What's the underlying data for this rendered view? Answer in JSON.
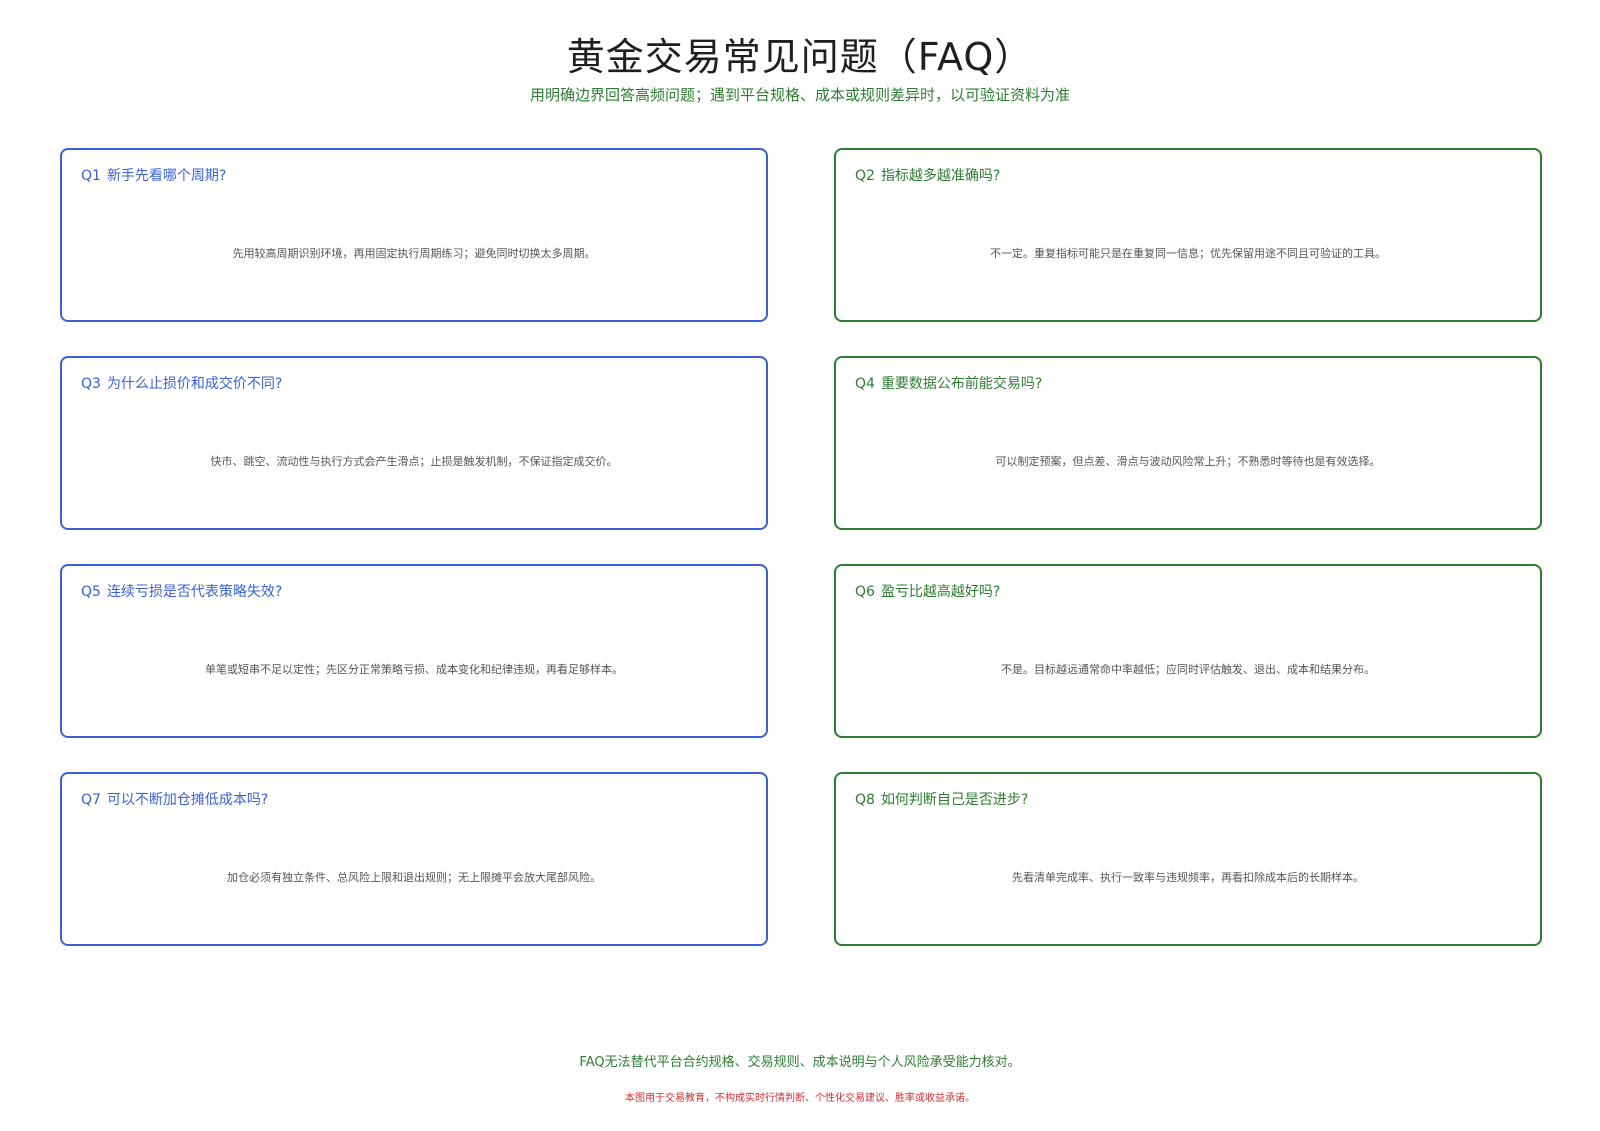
{
  "header": {
    "title": "黄金交易常见问题（FAQ）",
    "subtitle": "用明确边界回答高频问题；遇到平台规格、成本或规则差异时，以可验证资料为准"
  },
  "faq": [
    {
      "num": "Q1",
      "question": "新手先看哪个周期?",
      "answer": "先用较高周期识别环境，再用固定执行周期练习；避免同时切换太多周期。",
      "color": "#3a62d6"
    },
    {
      "num": "Q2",
      "question": "指标越多越准确吗?",
      "answer": "不一定。重复指标可能只是在重复同一信息；优先保留用途不同且可验证的工具。",
      "color": "#2e7d32"
    },
    {
      "num": "Q3",
      "question": "为什么止损价和成交价不同?",
      "answer": "快市、跳空、流动性与执行方式会产生滑点；止损是触发机制，不保证指定成交价。",
      "color": "#3a62d6"
    },
    {
      "num": "Q4",
      "question": "重要数据公布前能交易吗?",
      "answer": "可以制定预案，但点差、滑点与波动风险常上升；不熟悉时等待也是有效选择。",
      "color": "#2e7d32"
    },
    {
      "num": "Q5",
      "question": "连续亏损是否代表策略失效?",
      "answer": "单笔或短串不足以定性；先区分正常策略亏损、成本变化和纪律违规，再看足够样本。",
      "color": "#3a62d6"
    },
    {
      "num": "Q6",
      "question": "盈亏比越高越好吗?",
      "answer": "不是。目标越远通常命中率越低；应同时评估触发、退出、成本和结果分布。",
      "color": "#2e7d32"
    },
    {
      "num": "Q7",
      "question": "可以不断加仓摊低成本吗?",
      "answer": "加仓必须有独立条件、总风险上限和退出规则；无上限摊平会放大尾部风险。",
      "color": "#3a62d6"
    },
    {
      "num": "Q8",
      "question": "如何判断自己是否进步?",
      "answer": "先看清单完成率、执行一致率与违规频率，再看扣除成本后的长期样本。",
      "color": "#2e7d32"
    }
  ],
  "footer": {
    "note": "FAQ无法替代平台合约规格、交易规则、成本说明与个人风险承受能力核对。",
    "disclaimer": "本图用于交易教育，不构成实时行情判断、个性化交易建议、胜率或收益承诺。"
  }
}
